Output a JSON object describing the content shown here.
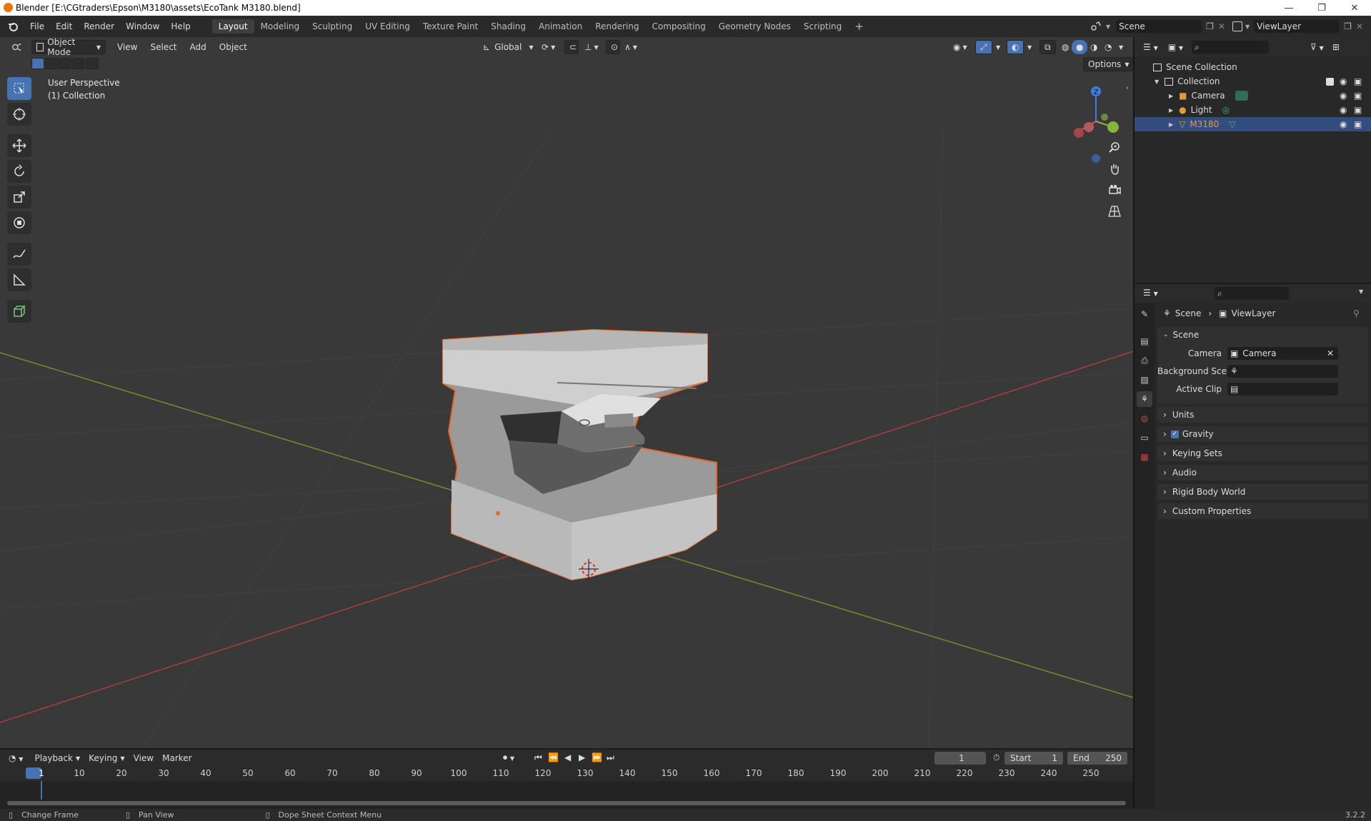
{
  "window": {
    "title": "Blender [E:\\CGtraders\\Epson\\M3180\\assets\\EcoTank M3180.blend]",
    "minimize": "—",
    "restore": "❐",
    "close": "✕"
  },
  "top_menu": [
    "File",
    "Edit",
    "Render",
    "Window",
    "Help"
  ],
  "workspaces": [
    "Layout",
    "Modeling",
    "Sculpting",
    "UV Editing",
    "Texture Paint",
    "Shading",
    "Animation",
    "Rendering",
    "Compositing",
    "Geometry Nodes",
    "Scripting"
  ],
  "workspace_add": "+",
  "scene_selector": "Scene",
  "viewlayer_selector": "ViewLayer",
  "viewport": {
    "mode": "Object Mode",
    "menus": [
      "View",
      "Select",
      "Add",
      "Object"
    ],
    "transform_orientation": "Global",
    "options": "Options",
    "overlay_line1": "User Perspective",
    "overlay_line2": "(1) Collection",
    "gizmo_z": "Z"
  },
  "outliner": {
    "root": "Scene Collection",
    "collection": "Collection",
    "items": [
      {
        "label": "Camera"
      },
      {
        "label": "Light"
      },
      {
        "label": "M3180"
      }
    ]
  },
  "properties": {
    "breadcrumb_scene": "Scene",
    "breadcrumb_viewlayer": "ViewLayer",
    "scene_panel": "Scene",
    "camera_label": "Camera",
    "camera_value": "Camera",
    "bg_scene_label": "Background Scene",
    "active_clip_label": "Active Clip",
    "panels": [
      "Units",
      "Gravity",
      "Keying Sets",
      "Audio",
      "Rigid Body World",
      "Custom Properties"
    ]
  },
  "timeline": {
    "menus": [
      "Playback",
      "Keying",
      "View",
      "Marker"
    ],
    "current_frame": "1",
    "start_label": "Start",
    "start_value": "1",
    "end_label": "End",
    "end_value": "250",
    "frame_marks": [
      "1",
      "10",
      "20",
      "30",
      "40",
      "50",
      "60",
      "70",
      "80",
      "90",
      "100",
      "110",
      "120",
      "130",
      "140",
      "150",
      "160",
      "170",
      "180",
      "190",
      "200",
      "210",
      "220",
      "230",
      "240",
      "250"
    ]
  },
  "statusbar": {
    "change_frame": "Change Frame",
    "pan_view": "Pan View",
    "context_menu": "Dope Sheet Context Menu",
    "version": "3.2.2"
  },
  "colors": {
    "accent": "#4772b3",
    "selection_outline": "#e8672a",
    "x_axis": "#a83f3f",
    "y_axis": "#6f8e2f"
  }
}
